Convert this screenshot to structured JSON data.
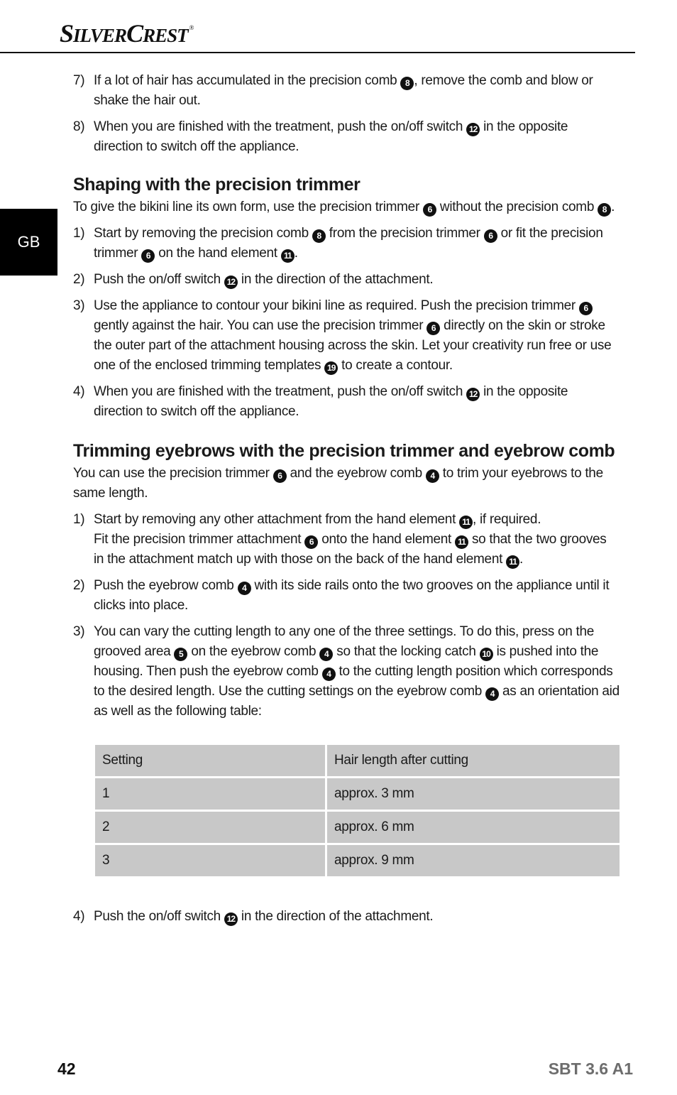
{
  "header": {
    "brand_big_1": "S",
    "brand_small_1": "ILVER",
    "brand_big_2": "C",
    "brand_small_2": "REST",
    "brand_mark": "®",
    "language_tab": "GB"
  },
  "intro_steps": [
    {
      "num": "7)",
      "segments": [
        {
          "t": "If a lot of hair has accumulated in the precision comb "
        },
        {
          "b": "8"
        },
        {
          "t": ", remove the comb and blow or shake the hair out."
        }
      ]
    },
    {
      "num": "8)",
      "segments": [
        {
          "t": "When you are finished with the treatment, push the on/off switch "
        },
        {
          "b": "12"
        },
        {
          "t": " in the opposite direction to switch off the appliance."
        }
      ]
    }
  ],
  "section_shaping": {
    "title": "Shaping with the precision trimmer",
    "intro": [
      {
        "t": "To give the bikini line its own form, use the precision trimmer "
      },
      {
        "b": "6"
      },
      {
        "t": " without the precision comb "
      },
      {
        "b": "8"
      },
      {
        "t": "."
      }
    ],
    "steps": [
      {
        "num": "1)",
        "segments": [
          {
            "t": "Start by removing the precision comb "
          },
          {
            "b": "8"
          },
          {
            "t": " from the precision trimmer "
          },
          {
            "b": "6"
          },
          {
            "t": " or fit the precision trimmer "
          },
          {
            "b": "6"
          },
          {
            "t": " on the hand element "
          },
          {
            "b": "11"
          },
          {
            "t": "."
          }
        ]
      },
      {
        "num": "2)",
        "segments": [
          {
            "t": "Push the on/off switch "
          },
          {
            "b": "12"
          },
          {
            "t": " in the direction of the attachment."
          }
        ]
      },
      {
        "num": "3)",
        "segments": [
          {
            "t": "Use the appliance to contour your bikini line as required. Push the precision trimmer "
          },
          {
            "b": "6"
          },
          {
            "t": " gently against the hair. You can use the precision trimmer "
          },
          {
            "b": "6"
          },
          {
            "t": " directly on the skin or stroke the outer part of the attachment housing across the skin. Let your creativity run free or use one of the enclosed trimming templates "
          },
          {
            "b": "19"
          },
          {
            "t": " to create a contour."
          }
        ]
      },
      {
        "num": "4)",
        "segments": [
          {
            "t": "When you are finished with the treatment, push the on/off switch "
          },
          {
            "b": "12"
          },
          {
            "t": " in the opposite direction to switch off the appliance."
          }
        ]
      }
    ]
  },
  "section_eyebrows": {
    "title": "Trimming eyebrows with the precision trimmer and eyebrow comb",
    "intro": [
      {
        "t": "You can use the precision trimmer "
      },
      {
        "b": "6"
      },
      {
        "t": " and the eyebrow comb "
      },
      {
        "b": "4"
      },
      {
        "t": " to trim your eyebrows to the same length."
      }
    ],
    "steps": [
      {
        "num": "1)",
        "segments": [
          {
            "t": "Start by removing any other attachment from the hand element "
          },
          {
            "b": "11"
          },
          {
            "t": ", if required."
          },
          {
            "br": true
          },
          {
            "t": "Fit the precision trimmer attachment "
          },
          {
            "b": "6"
          },
          {
            "t": " onto the hand element "
          },
          {
            "b": "11"
          },
          {
            "t": " so that the two grooves in the attachment match up with those on the back of the hand element "
          },
          {
            "b": "11"
          },
          {
            "t": "."
          }
        ]
      },
      {
        "num": "2)",
        "segments": [
          {
            "t": "Push the eyebrow comb "
          },
          {
            "b": "4"
          },
          {
            "t": " with its side rails onto the two grooves on the appliance until it clicks into place."
          }
        ]
      },
      {
        "num": "3)",
        "segments": [
          {
            "t": "You can vary the cutting length to any one of the three settings. To do this, press on the grooved area "
          },
          {
            "b": "5"
          },
          {
            "t": " on the eyebrow comb "
          },
          {
            "b": "4"
          },
          {
            "t": " so that the locking catch "
          },
          {
            "b": "10"
          },
          {
            "t": " is pushed into the housing. Then push the eyebrow comb "
          },
          {
            "b": "4"
          },
          {
            "t": " to the cutting length position which corresponds to the desired length. Use the cutting settings on the eyebrow comb "
          },
          {
            "b": "4"
          },
          {
            "t": " as an orientation aid as well as the following table:"
          }
        ]
      }
    ],
    "table": {
      "headers": [
        "Setting",
        "Hair length after cutting"
      ],
      "rows": [
        [
          "1",
          "approx. 3 mm"
        ],
        [
          "2",
          "approx. 6 mm"
        ],
        [
          "3",
          "approx. 9 mm"
        ]
      ]
    },
    "steps_after": [
      {
        "num": "4)",
        "segments": [
          {
            "t": "Push the on/off switch "
          },
          {
            "b": "12"
          },
          {
            "t": " in the direction of the attachment."
          }
        ]
      }
    ]
  },
  "footer": {
    "page_number": "42",
    "model": "SBT 3.6 A1"
  },
  "colors": {
    "table_cell": "#c8c8c8",
    "model_text": "#6d6d6d",
    "language_tab_bg": "#000000"
  }
}
